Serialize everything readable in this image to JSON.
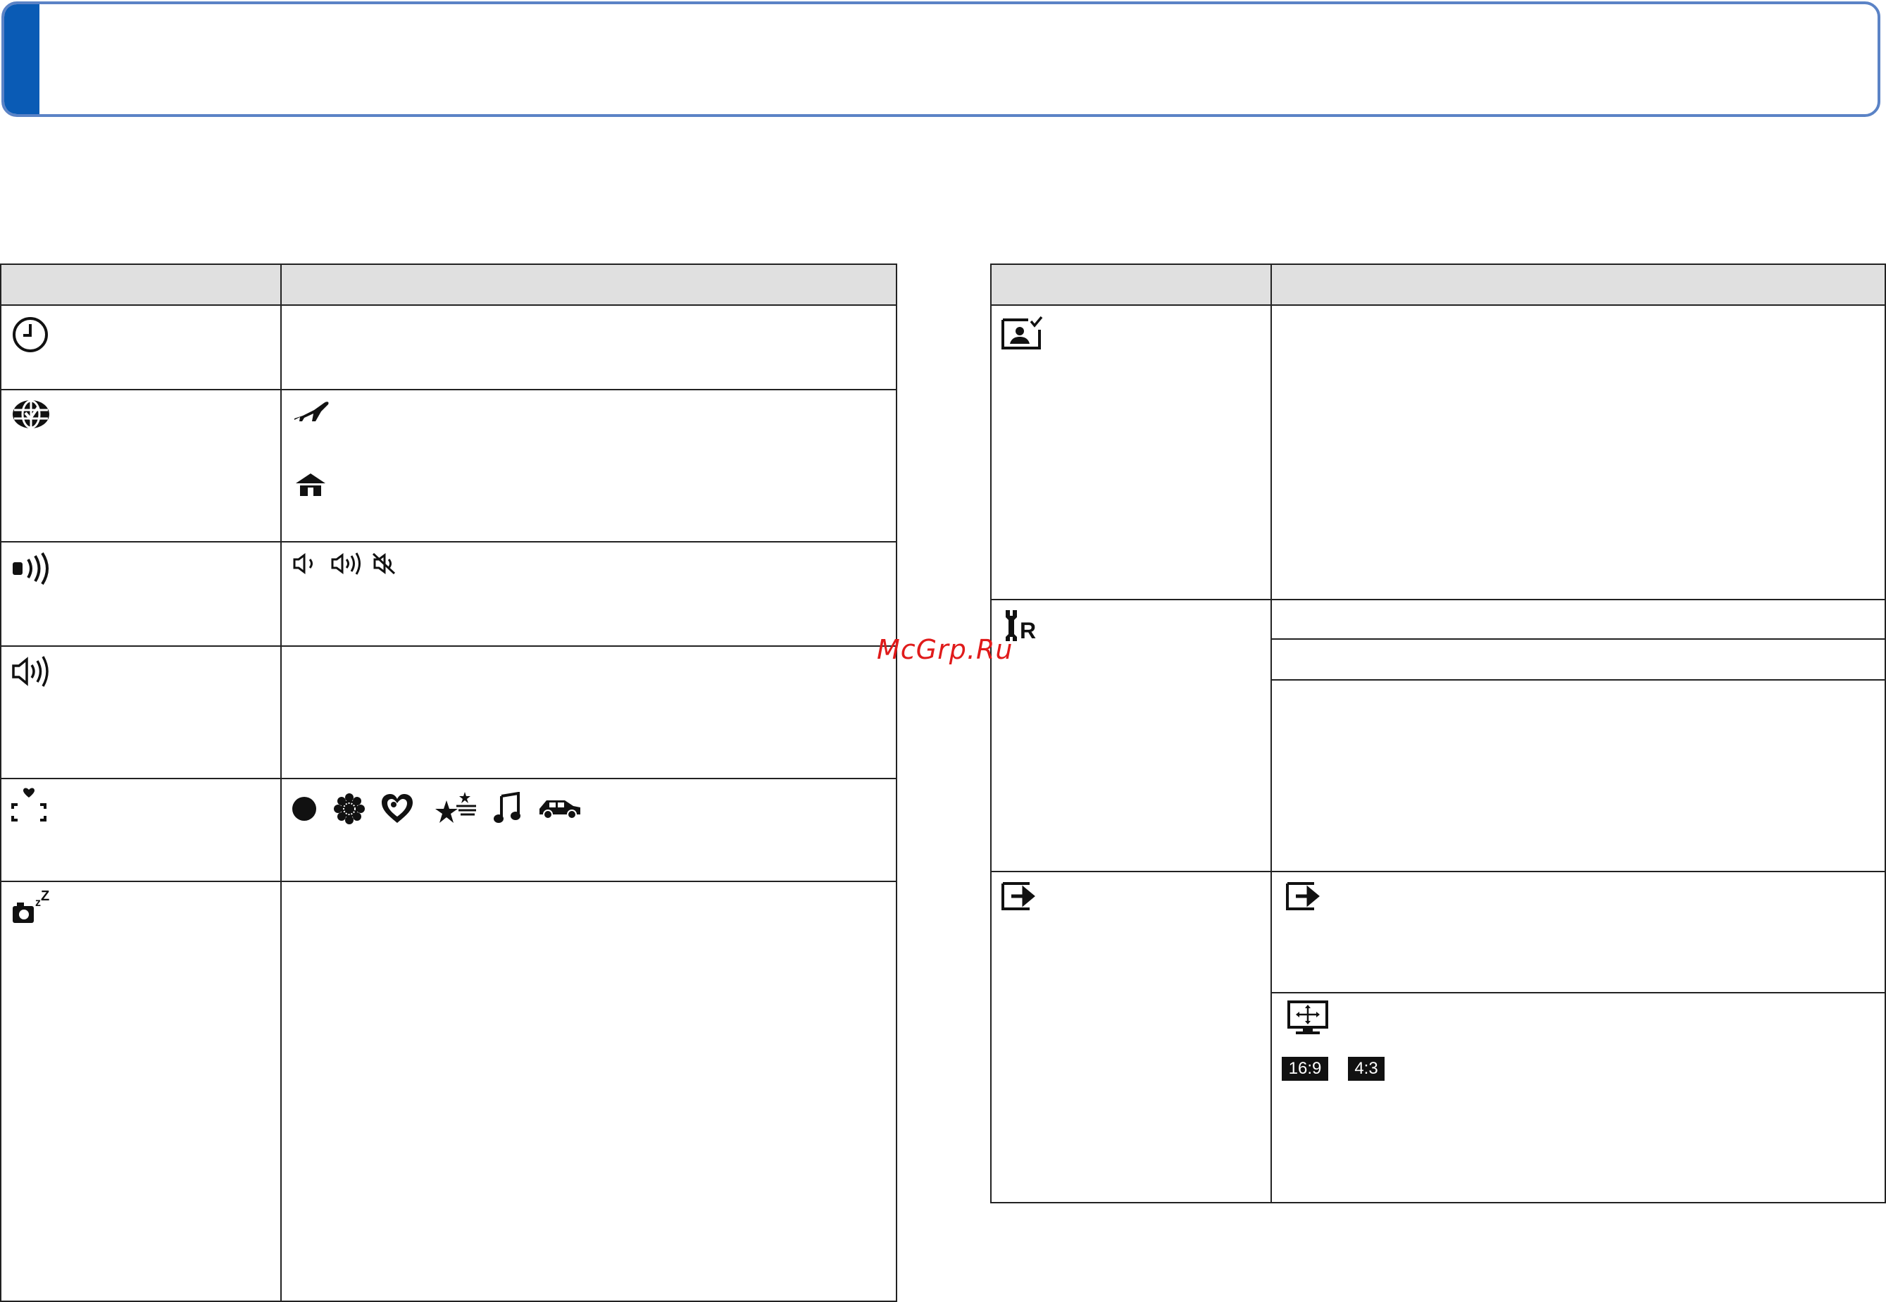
{
  "header": {
    "accent_color": "#0a5bb5",
    "border_color": "#5b83c6"
  },
  "left_table": {
    "rows": [
      {
        "setting_icon": "clock-icon"
      },
      {
        "setting_icon": "world-time-icon",
        "options": [
          "airplane-destination-icon",
          "home-icon"
        ]
      },
      {
        "setting_icon": "beep-icon",
        "options": [
          "speaker-low-icon",
          "speaker-high-icon",
          "speaker-mute-icon"
        ]
      },
      {
        "setting_icon": "shutter-volume-icon"
      },
      {
        "setting_icon": "focus-frame-heart-icon",
        "options": [
          "dot-icon",
          "flower-icon",
          "heart-lace-icon",
          "stars-icon",
          "music-note-icon",
          "car-icon"
        ]
      },
      {
        "setting_icon": "camera-sleep-icon"
      }
    ]
  },
  "right_table": {
    "rows": [
      {
        "setting_icon": "auto-review-icon"
      },
      {
        "setting_icon": "reset-wrench-icon"
      },
      {
        "setting_icon": "output-icon",
        "options": [
          "output-icon",
          "tv-aspect-icon"
        ],
        "aspect_badges": [
          "16:9",
          "4:3"
        ]
      }
    ]
  },
  "watermark": "McGrp.Ru"
}
